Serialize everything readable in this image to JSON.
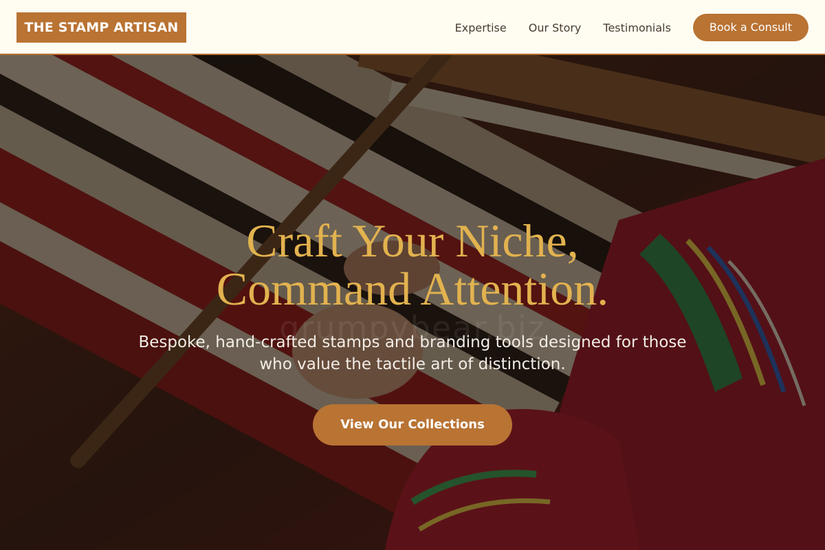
{
  "header": {
    "logo": "THE STAMP ARTISAN",
    "nav": [
      {
        "label": "Expertise"
      },
      {
        "label": "Our Story"
      },
      {
        "label": "Testimonials"
      }
    ],
    "cta_label": "Book a Consult"
  },
  "hero": {
    "title_line1": "Craft Your Niche,",
    "title_line2": "Command Attention.",
    "subtitle_line1": "Bespoke, hand-crafted stamps and branding tools designed for those",
    "subtitle_line2": "who value the tactile art of distinction.",
    "cta_label": "View Our Collections",
    "watermark": "grumpybear.biz",
    "background_image": "weaving-loom-photo"
  },
  "colors": {
    "accent": "#B97333",
    "header_bg": "#FFFDF2",
    "title": "#E2B24F",
    "subtitle": "#F2EDE6",
    "nav_text": "#4A3C30"
  }
}
